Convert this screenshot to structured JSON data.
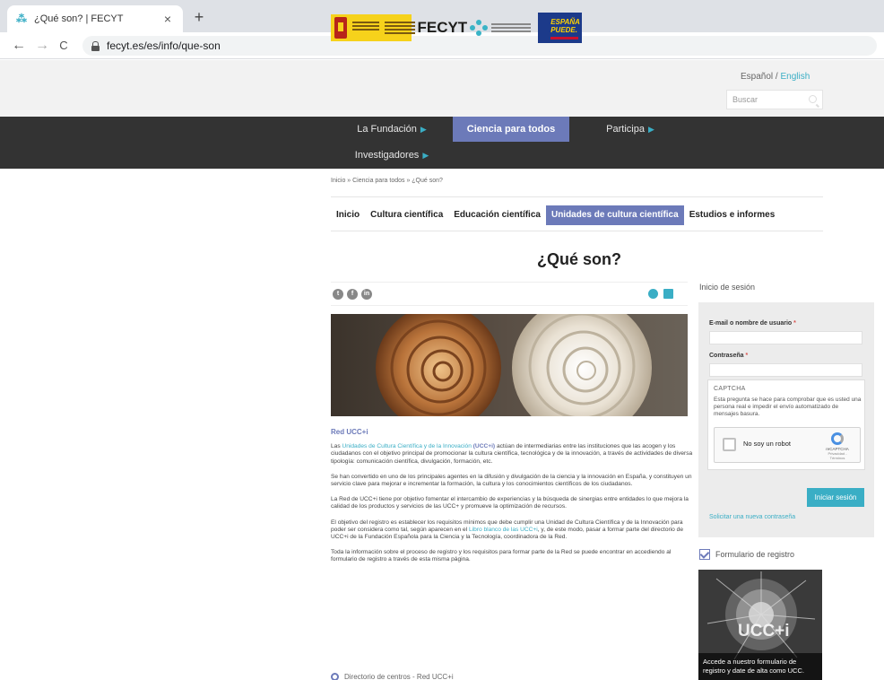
{
  "browser": {
    "tab_title": "¿Qué son? | FECYT",
    "tab_close": "×",
    "new_tab": "+",
    "url": "fecyt.es/es/info/que-son",
    "back": "←",
    "forward": "→",
    "reload": "C"
  },
  "header": {
    "fecyt_word": "FECYT",
    "espana_line1": "ESPAÑA",
    "espana_line2": "PUEDE.",
    "lang_es": "Español",
    "lang_sep": " / ",
    "lang_en": "English",
    "search_placeholder": "Buscar"
  },
  "mainnav": [
    {
      "label": "La Fundación",
      "arrow": "▶"
    },
    {
      "label": "Ciencia para todos"
    },
    {
      "label": "Participa",
      "arrow": "▶"
    },
    {
      "label": "Investigadores",
      "arrow": "▶"
    }
  ],
  "breadcrumb": "Inicio » Ciencia para todos » ¿Qué son?",
  "subnav": [
    "Inicio",
    "Cultura científica",
    "Educación científica",
    "Unidades de cultura científica",
    "Estudios e informes"
  ],
  "page_title": "¿Qué son?",
  "share": {
    "twitter": "t",
    "facebook": "f",
    "linkedin": "in"
  },
  "article": {
    "heading": "Red UCC+i",
    "p1_a": "Las ",
    "p1_link": "Unidades de Cultura Científica y de la Innovación",
    "p1_b": " ",
    "p1_strong": "(UCC+i)",
    "p1_c": " actúan de intermediarias entre las instituciones que las acogen y los ciudadanos con el objetivo principal de promocionar la cultura científica, tecnológica y de la innovación, a través de actividades de diversa tipología: comunicación científica, divulgación, formación, etc.",
    "p2": "Se han convertido en uno de los principales agentes en la difusión y divulgación de la ciencia y la innovación en España, y constituyen un servicio clave para mejorar e incrementar la formación, la cultura y los conocimientos científicos de los ciudadanos.",
    "p3": "La Red de UCC+i tiene por objetivo fomentar el intercambio de experiencias y la búsqueda de sinergias entre entidades lo que mejora la calidad de los productos y servicios de las UCC+ y promueve la optimización de recursos.",
    "p4_a": "El objetivo del registro es establecer los requisitos mínimos que debe cumplir una Unidad de Cultura Científica y de la Innovación para poder ser considera como tal, según aparecen en el ",
    "p4_link": "Libro blanco de las UCC+i",
    "p4_b": ", y, de este modo, pasar a formar parte del directorio de UCC+i de la Fundación Española para la Ciencia y la Tecnología, coordinadora de la Red.",
    "p5": "Toda la información sobre el proceso de registro y los requisitos para formar parte de la Red se puede encontrar en accediendo al formulario de registro a través de esta misma página.",
    "directory": "Directorio de centros - Red UCC+i"
  },
  "login": {
    "title": "Inicio de sesión",
    "user_label": "E-mail o nombre de usuario",
    "pass_label": "Contraseña",
    "required_mark": "*",
    "captcha_legend": "CAPTCHA",
    "captcha_desc": "Esta pregunta se hace para comprobar que es usted una persona real e impedir el envío automatizado de mensajes basura.",
    "recaptcha_label": "No soy un robot",
    "recaptcha_name": "reCAPTCHA",
    "recaptcha_links": "Privacidad - Términos",
    "submit": "Iniciar sesión",
    "new_password": "Solicitar una nueva contraseña"
  },
  "register": {
    "label": "Formulario de registro",
    "promo_logo": "UCC+i",
    "promo_caption": "Accede a nuestro formulario de registro y date de alta como UCC."
  },
  "colors": {
    "accent_purple": "#6c7ab9",
    "accent_cyan": "#3aaec5",
    "nav_dark": "#333333"
  }
}
